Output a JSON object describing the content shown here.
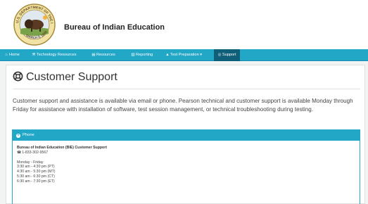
{
  "header": {
    "site_title": "Bureau of Indian Education",
    "seal": {
      "top_text": "U.S. DEPARTMENT OF THE INTERIOR",
      "bottom_text": "MARCH 3, 1849"
    }
  },
  "nav": {
    "items": [
      {
        "icon": "home-icon",
        "glyph": "⌂",
        "label": "Home"
      },
      {
        "icon": "wrench-icon",
        "glyph": "⚒",
        "label": "Technology Resources"
      },
      {
        "icon": "files-icon",
        "glyph": "▤",
        "label": "Resources"
      },
      {
        "icon": "bar-chart-icon",
        "glyph": "▥",
        "label": "Reporting"
      },
      {
        "icon": "mortarboard-icon",
        "glyph": "▲",
        "label": "Test Preparation ▾"
      },
      {
        "icon": "lifebuoy-icon",
        "glyph": "◎",
        "label": "Support"
      }
    ],
    "active_index": 5
  },
  "main": {
    "title": "Customer Support",
    "intro": "Customer support and assistance is available via email or phone. Pearson technical and customer support is available Monday through Friday for assistance with installation of software, test session management, or technical troubleshooting during testing."
  },
  "panel": {
    "heading": "Phone",
    "org": "Bureau of Indian Education (BIE) Customer Support",
    "phone": "1-833-302-9567",
    "days": "Monday - Friday",
    "hours": [
      "3:30 am - 4:30 pm (PT)",
      "4:30 am - 5:30 pm (MT)",
      "5:30 am - 6:30 pm (CT)",
      "6:30 am - 7:30 pm (ET)"
    ]
  },
  "colors": {
    "nav_bg": "#22a7c7",
    "nav_active": "#0f5f78",
    "panel_heading": "#22a7c7"
  }
}
